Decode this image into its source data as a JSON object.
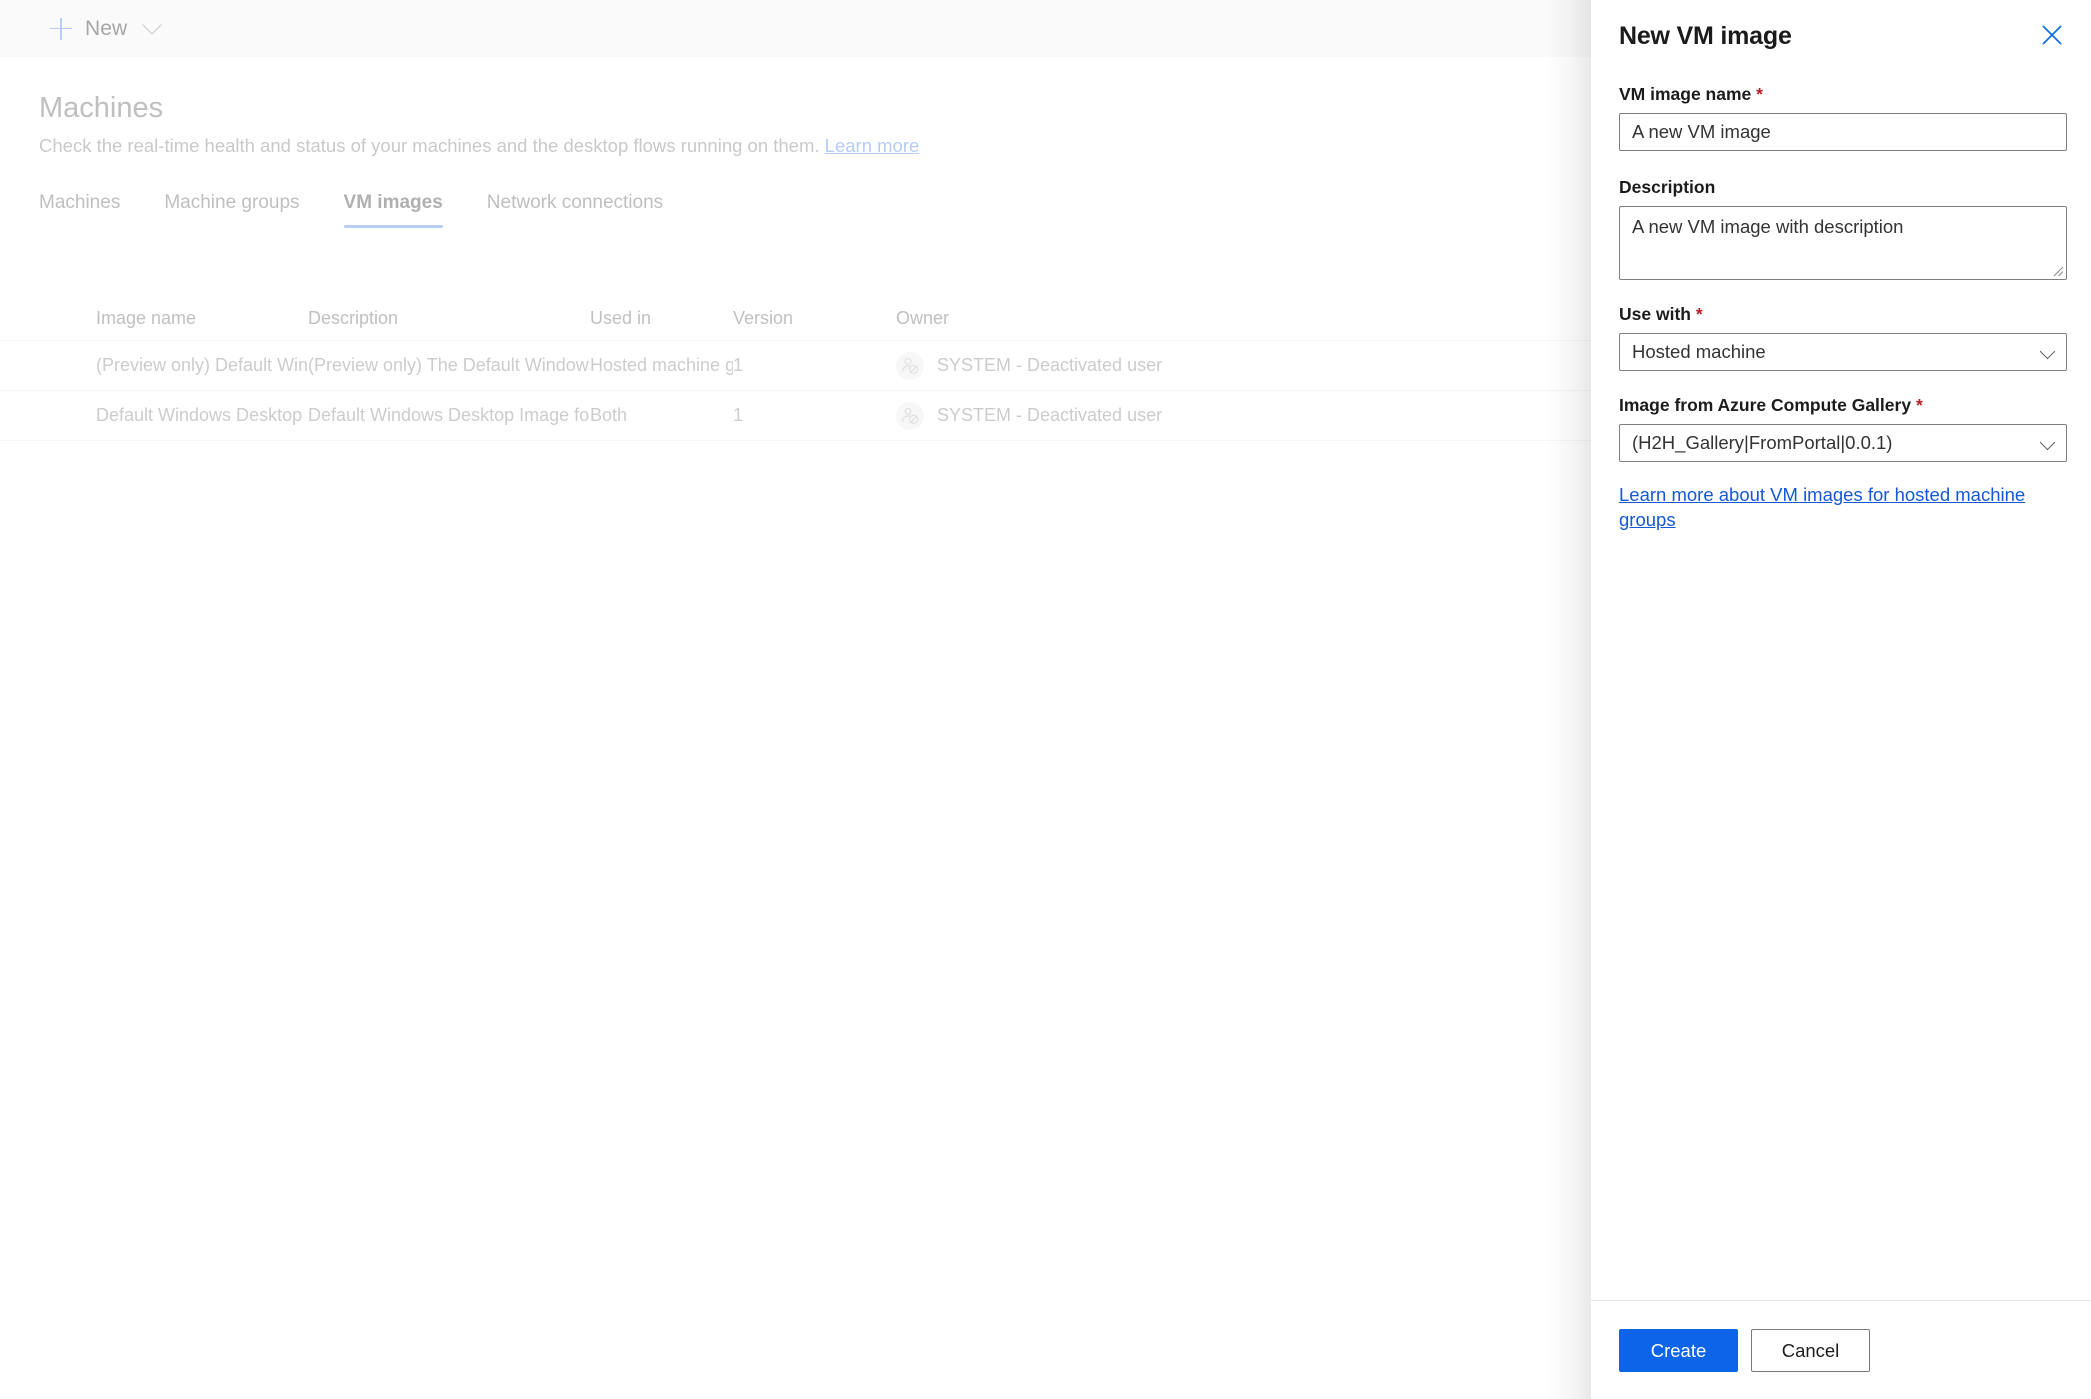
{
  "toolbar": {
    "new_label": "New"
  },
  "page": {
    "title": "Machines",
    "subtitle_text": "Check the real-time health and status of your machines and the desktop flows running on them.",
    "subtitle_link": "Learn more"
  },
  "tabs": [
    {
      "label": "Machines",
      "active": false
    },
    {
      "label": "Machine groups",
      "active": false
    },
    {
      "label": "VM images",
      "active": true
    },
    {
      "label": "Network connections",
      "active": false
    }
  ],
  "table": {
    "columns": [
      "Image name",
      "Description",
      "Used in",
      "Version",
      "Owner"
    ],
    "rows": [
      {
        "image_name": "(Preview only) Default Windo...",
        "description": "(Preview only) The Default Windows Desk...",
        "used_in": "Hosted machine group",
        "version": "1",
        "owner": "SYSTEM - Deactivated user"
      },
      {
        "image_name": "Default Windows Desktop I...",
        "description": "Default Windows Desktop Image for use i...",
        "used_in": "Both",
        "version": "1",
        "owner": "SYSTEM - Deactivated user"
      }
    ]
  },
  "panel": {
    "title": "New VM image",
    "close_icon": "close-icon",
    "fields": {
      "vm_name_label": "VM image name",
      "vm_name_value": "A new VM image",
      "description_label": "Description",
      "description_value": "A new VM image with description",
      "use_with_label": "Use with",
      "use_with_value": "Hosted machine",
      "gallery_label": "Image from Azure Compute Gallery",
      "gallery_value": "(H2H_Gallery|FromPortal|0.0.1)",
      "required_marker": "*"
    },
    "learn_link": "Learn more about VM images for hosted machine groups",
    "create_label": "Create",
    "cancel_label": "Cancel"
  },
  "colors": {
    "accent_blue": "#0d64e8",
    "tab_underline": "#7aa7ef",
    "link_blue": "#1558d6",
    "required_red": "#b81f24",
    "toolbar_bg": "#f6f6f6"
  }
}
